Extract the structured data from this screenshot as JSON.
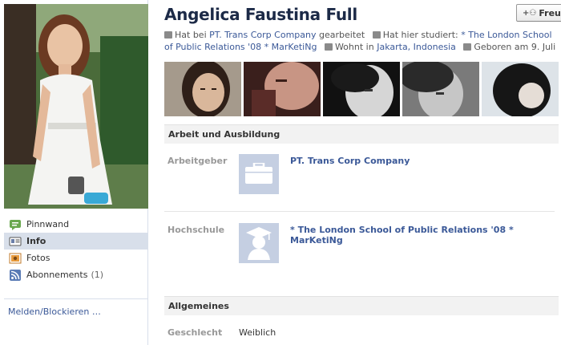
{
  "profile": {
    "name": "Angelica Faustina Full",
    "friend_button_label": "Freunde"
  },
  "info_line": {
    "work_prefix": "Hat bei",
    "work_place": "PT. Trans Corp Company",
    "work_suffix": "gearbeitet",
    "study_prefix": "Hat hier studiert:",
    "study_place": "* The London School of Public Relations '08 * MarKetiNg",
    "live_prefix": "Wohnt in",
    "live_place": "Jakarta, Indonesia",
    "birthday": "Geboren am 9. Juli"
  },
  "side_nav": {
    "items": [
      {
        "label": "Pinnwand",
        "icon": "wall-icon"
      },
      {
        "label": "Info",
        "icon": "info-icon",
        "active": true
      },
      {
        "label": "Fotos",
        "icon": "photos-icon"
      },
      {
        "label": "Abonnements",
        "icon": "subscriptions-icon",
        "count": "(1)"
      }
    ],
    "report_link": "Melden/Blockieren …"
  },
  "sections": {
    "work_education": {
      "title": "Arbeit und Ausbildung",
      "employer_label": "Arbeitgeber",
      "employer_value": "PT. Trans Corp Company",
      "college_label": "Hochschule",
      "college_value": "* The London School of Public Relations '08 * MarKetiNg"
    },
    "general": {
      "title": "Allgemeines",
      "gender_label": "Geschlecht",
      "gender_value": "Weiblich"
    }
  },
  "colors": {
    "link": "#3b5998",
    "name": "#1c2a47",
    "nav_active": "#d8dfea",
    "section_bg": "#f2f2f2",
    "placeholder_thumb": "#c5cfe2"
  }
}
